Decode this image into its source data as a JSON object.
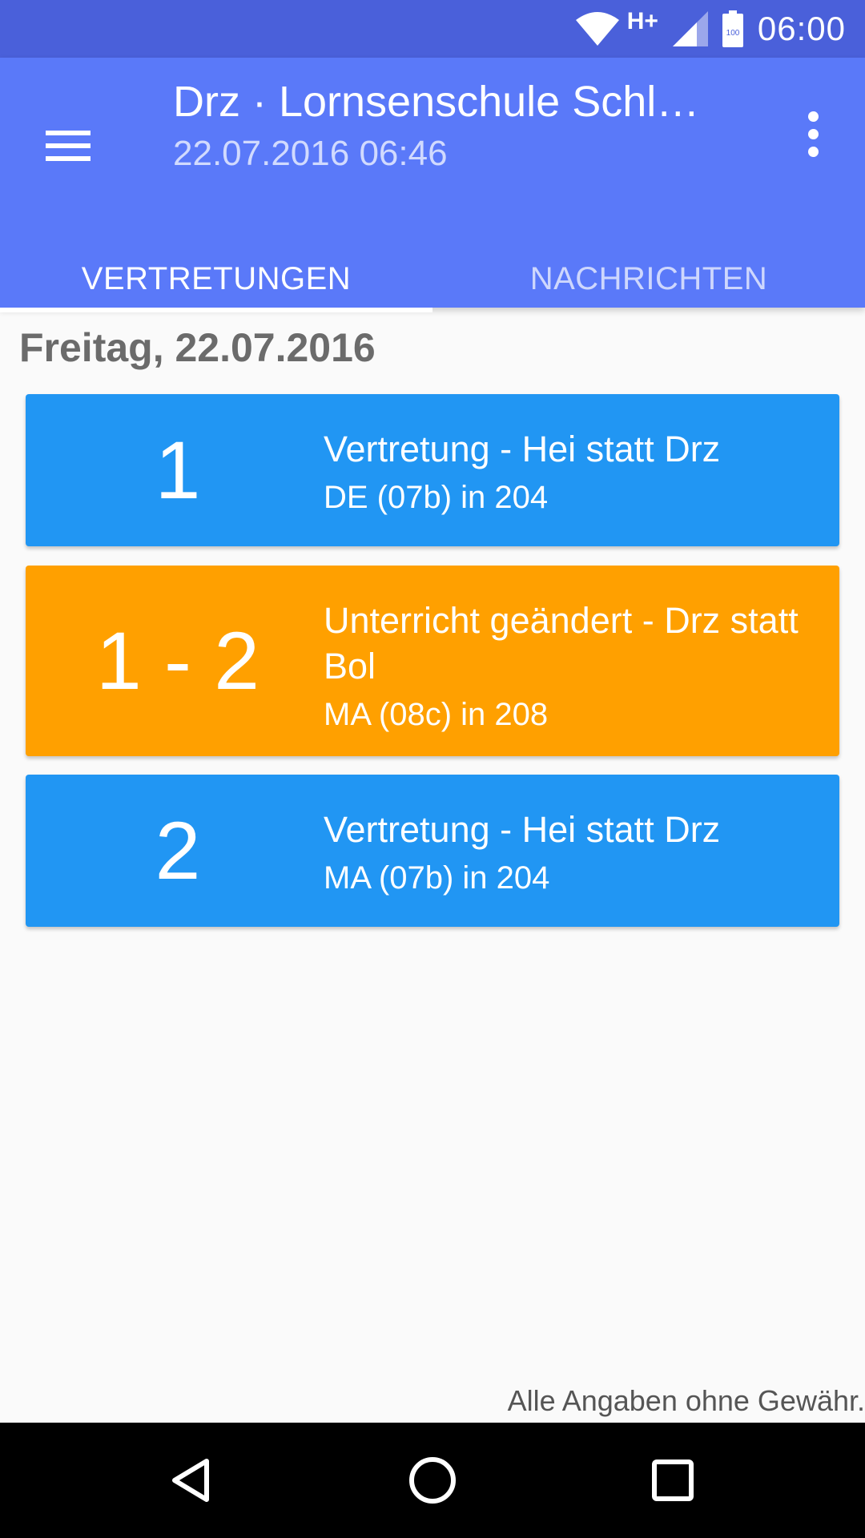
{
  "status_bar": {
    "network_type": "H+",
    "battery_level": "100",
    "time": "06:00",
    "icons": [
      "wifi-icon",
      "cell-signal-icon",
      "battery-icon"
    ],
    "color": "#4a60da"
  },
  "app_bar": {
    "title": "Drz · Lornsenschule Schl…",
    "subtitle": "22.07.2016 06:46",
    "menu_icon": "hamburger-menu-icon",
    "overflow_icon": "more-vert-icon",
    "color": "#5a79f9"
  },
  "tabs": [
    {
      "label": "VERTRETUNGEN",
      "active": true
    },
    {
      "label": "NACHRICHTEN",
      "active": false
    }
  ],
  "day_heading": "Freitag, 22.07.2016",
  "entries": [
    {
      "period": "1",
      "headline": "Vertretung - Hei statt Drz",
      "details": "DE (07b) in 204",
      "color": "#2196f3"
    },
    {
      "period": "1 - 2",
      "headline": "Unterricht geändert - Drz statt Bol",
      "details": "MA (08c) in 208",
      "color": "#ffa000"
    },
    {
      "period": "2",
      "headline": "Vertretung - Hei statt Drz",
      "details": "MA (07b) in 204",
      "color": "#2196f3"
    }
  ],
  "disclaimer": "Alle Angaben ohne Gewähr.",
  "nav_bar": {
    "icons": [
      "back-icon",
      "home-icon",
      "recent-apps-icon"
    ]
  }
}
